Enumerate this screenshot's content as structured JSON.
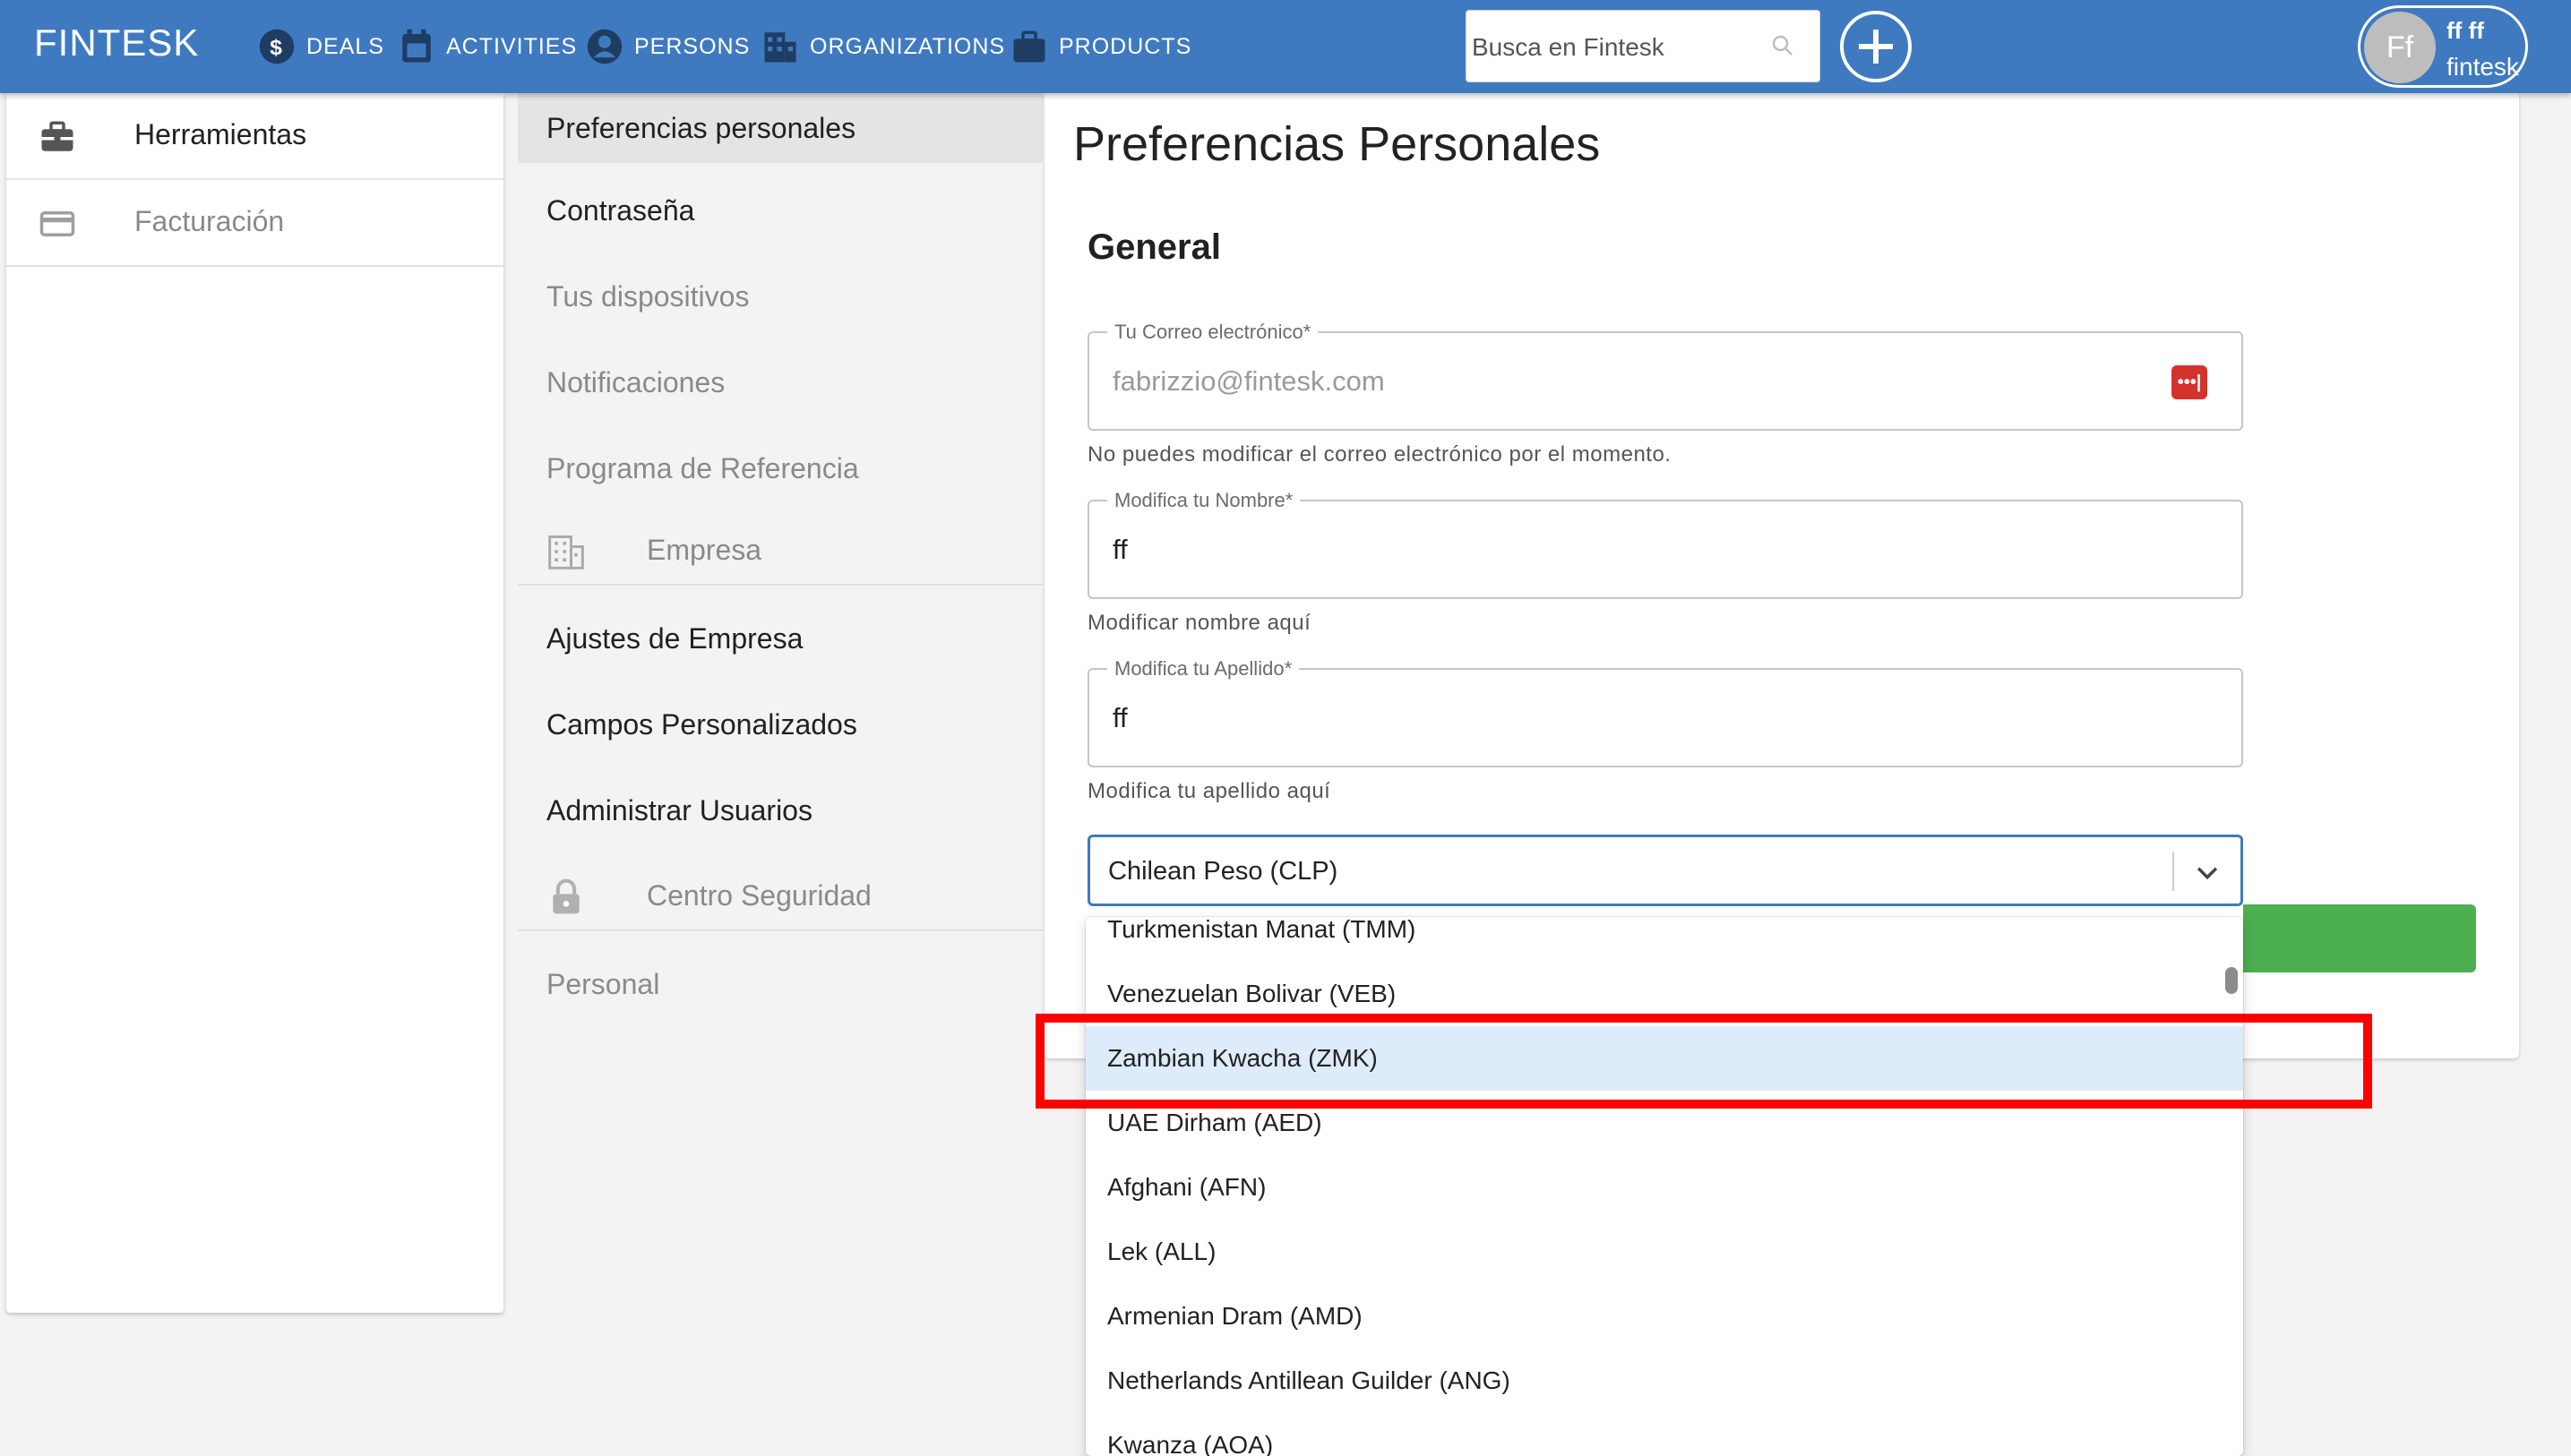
{
  "topbar": {
    "brand": "FINTESK",
    "nav": [
      {
        "label": "DEALS",
        "icon": "dollar-icon"
      },
      {
        "label": "ACTIVITIES",
        "icon": "calendar-icon"
      },
      {
        "label": "PERSONS",
        "icon": "person-icon"
      },
      {
        "label": "ORGANIZATIONS",
        "icon": "building-icon"
      },
      {
        "label": "PRODUCTS",
        "icon": "briefcase-icon"
      }
    ],
    "search_placeholder": "Busca en Fintesk",
    "user": {
      "initials": "Ff",
      "name": "ff ff",
      "org": "fintesk"
    }
  },
  "sidebar": {
    "items": [
      {
        "label": "Herramientas",
        "icon": "toolbox-icon"
      },
      {
        "label": "Facturación",
        "icon": "credit-card-icon"
      }
    ]
  },
  "menu": {
    "personal": [
      "Preferencias personales",
      "Contraseña",
      "Tus dispositivos",
      "Notificaciones",
      "Programa de Referencia"
    ],
    "company_header": "Empresa",
    "company": [
      "Ajustes de Empresa",
      "Campos Personalizados",
      "Administrar Usuarios"
    ],
    "security_header": "Centro Seguridad",
    "personal_header": "Personal"
  },
  "main": {
    "title": "Preferencias Personales",
    "section": "General",
    "email": {
      "label": "Tu Correo electrónico",
      "value": "fabrizzio@fintesk.com",
      "helper": "No puedes modificar el correo electrónico por el momento.",
      "badge": "•••|"
    },
    "first_name": {
      "label": "Modifica tu Nombre",
      "value": "ff",
      "helper": "Modificar nombre aquí"
    },
    "last_name": {
      "label": "Modifica tu Apellido",
      "value": "ff",
      "helper": "Modifica tu apellido aquí"
    },
    "required_mark": "*",
    "currency": {
      "selected": "Chilean Peso (CLP)",
      "options": [
        "Turkmenistan Manat (TMM)",
        "Venezuelan Bolivar (VEB)",
        "Zambian Kwacha (ZMK)",
        "UAE Dirham (AED)",
        "Afghani (AFN)",
        "Lek (ALL)",
        "Armenian Dram (AMD)",
        "Netherlands Antillean Guilder (ANG)",
        "Kwanza (AOA)"
      ],
      "highlighted_index": 2
    }
  },
  "colors": {
    "topbar": "#3f7ac0",
    "highlight": "#deebfb",
    "annotation": "#ff0000",
    "button_green": "#4caf50"
  }
}
